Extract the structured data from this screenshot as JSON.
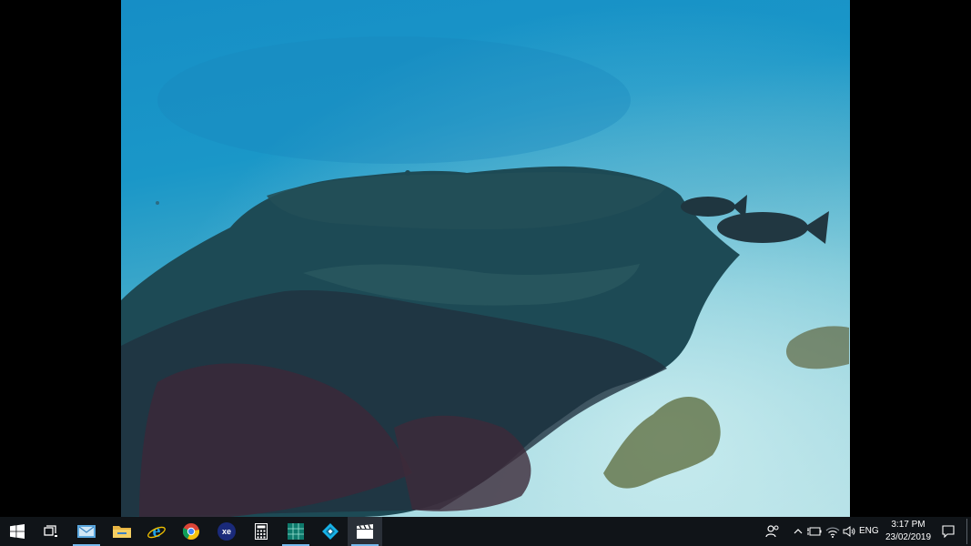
{
  "taskbar": {
    "apps": [
      {
        "name": "start",
        "icon": "windows-logo-icon"
      },
      {
        "name": "task-view",
        "icon": "task-view-icon"
      },
      {
        "name": "mail",
        "icon": "mail-icon"
      },
      {
        "name": "file-explorer",
        "icon": "folder-icon"
      },
      {
        "name": "internet-explorer",
        "icon": "internet-explorer-icon"
      },
      {
        "name": "chrome",
        "icon": "chrome-icon"
      },
      {
        "name": "xe-currency",
        "icon": "xe-icon",
        "label": "xe"
      },
      {
        "name": "calculator",
        "icon": "calculator-icon"
      },
      {
        "name": "spreadsheet-app",
        "icon": "spreadsheet-icon"
      },
      {
        "name": "kodi",
        "icon": "kodi-icon"
      },
      {
        "name": "video-player",
        "icon": "clapperboard-icon"
      }
    ],
    "tray": {
      "language": "ENG",
      "time": "3:17 PM",
      "date": "23/02/2019"
    }
  },
  "colors": {
    "taskbar_bg": "#101418",
    "running_indicator": "#76b9ed"
  }
}
